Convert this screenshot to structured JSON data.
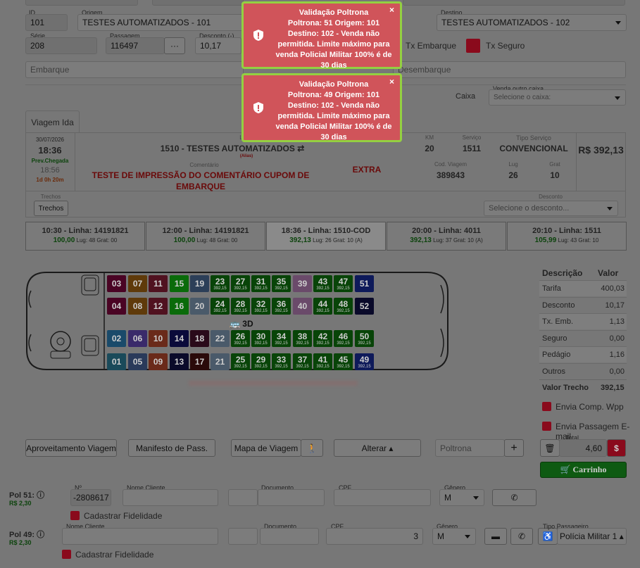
{
  "header": {
    "id_label": "ID",
    "id_value": "101",
    "origem_label": "Origem",
    "origem_value": "TESTES AUTOMATIZADOS - 101",
    "destino_label": "Destino",
    "destino_value": "TESTES AUTOMATIZADOS - 102",
    "serie_label": "Série",
    "serie_value": "208",
    "passagem_label": "Passagem",
    "passagem_value": "116497",
    "desconto_label": "Desconto (-)",
    "desconto_value": "10,17",
    "ellipsis": "···",
    "tx_embarque_label": "Tx Embarque",
    "tx_seguro_label": "Tx Seguro",
    "embarque_placeholder": "Embarque",
    "desembarque_placeholder": "Desembarque",
    "caixa_label": "Caixa",
    "venda_outro_caixa_label": "Venda outro caixa",
    "caixa_placeholder": "Selecione o caixa:"
  },
  "tabs": [
    {
      "label": "Viagem Ida"
    }
  ],
  "trip": {
    "date": "30/07/2026",
    "time": "18:36",
    "prev_chegada_label": "Prev.Chegada",
    "arrival": "18:56",
    "duration": "1d 0h 20m",
    "linha_label": "Linha",
    "linha_value": "1510 - TESTES AUTOMATIZADOS",
    "alias": "(Alias)",
    "km_label": "KM",
    "km_value": "20",
    "servico_label": "Serviço",
    "servico_value": "1511",
    "tipo_servico_label": "Tipo Serviço",
    "tipo_servico_value": "CONVENCIONAL",
    "price": "R$ 392,13",
    "comentario_label": "Comentário",
    "comentario_value": "TESTE DE IMPRESSÃO DO COMENTÁRIO CUPOM DE EMBARQUE",
    "extra": "EXTRA",
    "cod_viagem_label": "Cod. Viagem",
    "cod_viagem_value": "389843",
    "lug_label": "Lug",
    "lug_value": "26",
    "grat_label": "Grat",
    "grat_value": "10",
    "trechos_label": "Trechos",
    "trechos_button": "Trechos",
    "desconto_label": "Desconto",
    "desconto_placeholder": "Selecione o desconto..."
  },
  "schedules": [
    {
      "title": "10:30 - Linha: 14191821",
      "price": "100,00",
      "info": "Lug: 48 Grat: 00"
    },
    {
      "title": "12:00 - Linha: 14191821",
      "price": "100,00",
      "info": "Lug: 48 Grat: 00"
    },
    {
      "title": "18:36 - Linha: 1510-COD",
      "price": "392,13",
      "info": "Lug: 26 Grat: 10 (A)"
    },
    {
      "title": "20:00 - Linha: 4011",
      "price": "392,13",
      "info": "Lug: 37 Grat: 10 (A)"
    },
    {
      "title": "20:10 - Linha: 1511",
      "price": "105,99",
      "info": "Lug: 43 Grat: 10"
    }
  ],
  "bus": {
    "label_3d": "3D",
    "seat_price": "392,15",
    "seats": [
      {
        "n": "03",
        "c": "#4a0424"
      },
      {
        "n": "07",
        "c": "#5f3a0a"
      },
      {
        "n": "11",
        "c": "#501220"
      },
      {
        "n": "15",
        "c": "#0a6b0a"
      },
      {
        "n": "19",
        "c": "#2c3f58"
      },
      {
        "n": "23",
        "c": "#084408",
        "p": true
      },
      {
        "n": "27",
        "c": "#084408",
        "p": true
      },
      {
        "n": "31",
        "c": "#084408",
        "p": true
      },
      {
        "n": "35",
        "c": "#084408",
        "p": true
      },
      {
        "n": "39",
        "c": "#6a4a6a"
      },
      {
        "n": "43",
        "c": "#084408",
        "p": true
      },
      {
        "n": "47",
        "c": "#084408",
        "p": true
      },
      {
        "n": "51",
        "c": "#0e1a5a"
      },
      {
        "n": "04",
        "c": "#4a0424"
      },
      {
        "n": "08",
        "c": "#5f3a0a"
      },
      {
        "n": "12",
        "c": "#501220"
      },
      {
        "n": "16",
        "c": "#0a6b0a"
      },
      {
        "n": "20",
        "c": "#4a5a6a"
      },
      {
        "n": "24",
        "c": "#084408",
        "p": true
      },
      {
        "n": "28",
        "c": "#084408",
        "p": true
      },
      {
        "n": "32",
        "c": "#084408",
        "p": true
      },
      {
        "n": "36",
        "c": "#084408",
        "p": true
      },
      {
        "n": "40",
        "c": "#6a4a6a"
      },
      {
        "n": "44",
        "c": "#084408",
        "p": true
      },
      {
        "n": "48",
        "c": "#084408",
        "p": true
      },
      {
        "n": "52",
        "c": "#0a0a2a"
      },
      {
        "n": "02",
        "c": "#1a4a6a"
      },
      {
        "n": "06",
        "c": "#3a2a6a"
      },
      {
        "n": "10",
        "c": "#6a2a1a"
      },
      {
        "n": "14",
        "c": "#0a0a3a"
      },
      {
        "n": "18",
        "c": "#2a0a1a"
      },
      {
        "n": "22",
        "c": "#4a5a6a"
      },
      {
        "n": "26",
        "c": "#084408",
        "p": true
      },
      {
        "n": "30",
        "c": "#084408",
        "p": true
      },
      {
        "n": "34",
        "c": "#084408",
        "p": true
      },
      {
        "n": "38",
        "c": "#084408",
        "p": true
      },
      {
        "n": "42",
        "c": "#084408",
        "p": true
      },
      {
        "n": "46",
        "c": "#084408",
        "p": true
      },
      {
        "n": "50",
        "c": "#084408",
        "p": true
      },
      {
        "n": "01",
        "c": "#1a4a5a"
      },
      {
        "n": "05",
        "c": "#2a3a5a"
      },
      {
        "n": "09",
        "c": "#6a2a1a"
      },
      {
        "n": "13",
        "c": "#0a0a2a"
      },
      {
        "n": "17",
        "c": "#2a0a0a"
      },
      {
        "n": "21",
        "c": "#4a5a6a"
      },
      {
        "n": "25",
        "c": "#084408",
        "p": true
      },
      {
        "n": "29",
        "c": "#084408",
        "p": true
      },
      {
        "n": "33",
        "c": "#084408",
        "p": true
      },
      {
        "n": "37",
        "c": "#084408",
        "p": true
      },
      {
        "n": "41",
        "c": "#084408",
        "p": true
      },
      {
        "n": "45",
        "c": "#084408",
        "p": true
      },
      {
        "n": "49",
        "c": "#0e1a5a",
        "p": true
      }
    ]
  },
  "totals": {
    "descricao_header": "Descrição",
    "valor_header": "Valor",
    "rows": [
      {
        "label": "Tarifa",
        "value": "400,03"
      },
      {
        "label": "Desconto",
        "value": "10,17"
      },
      {
        "label": "Tx. Emb.",
        "value": "1,13"
      },
      {
        "label": "Seguro",
        "value": "0,00"
      },
      {
        "label": "Pedágio",
        "value": "1,16"
      },
      {
        "label": "Outros",
        "value": "0,00"
      }
    ],
    "valor_trecho_label": "Valor Trecho",
    "valor_trecho_value": "392,15",
    "envia_wpp": "Envia Comp. Wpp",
    "envia_email": "Envia Passagem E-mail",
    "total_label": "Total",
    "total_value": "4,60",
    "carrinho": "Carrinho"
  },
  "actions": {
    "aproveitamento": "Aproveitamento Viagem",
    "manifesto": "Manifesto de Pass.",
    "mapa": "Mapa de Viagem",
    "alterar": "Alterar",
    "poltrona_placeholder": "Poltrona",
    "plus": "+"
  },
  "passengers": [
    {
      "pol": "Pol 51:",
      "price": "R$ 2,30",
      "n_label": "Nº",
      "n_value": "-2808617",
      "nome_label": "Nome Cliente",
      "doc_label": "Documento",
      "cpf_label": "CPF",
      "genero_label": "Gênero",
      "genero_value": "M",
      "fidelidade": "Cadastrar Fidelidade"
    },
    {
      "pol": "Pol 49:",
      "price": "R$ 2,30",
      "nome_label": "Nome Cliente",
      "doc_label": "Documento",
      "cpf_label": "CPF",
      "cpf_partial": "3",
      "genero_label": "Gênero",
      "genero_value": "M",
      "tipo_label": "Tipo Passageiro",
      "tipo_value": "Polícia Militar 1",
      "fidelidade": "Cadastrar Fidelidade"
    }
  ],
  "toasts": [
    {
      "title": "Validação Poltrona",
      "message": "Poltrona: 51 Origem: 101 Destino: 102 - Venda não permitida. Limite máximo para venda Policial Militar 100% é de 30 dias"
    },
    {
      "title": "Validação Poltrona",
      "message": "Poltrona: 49 Origem: 101 Destino: 102 - Venda não permitida. Limite máximo para venda Policial Militar 100% é de 30 dias"
    }
  ],
  "colors": {
    "toast_bg": "#d0545a",
    "toast_border": "#94d041",
    "carrinho": "#0e5a12",
    "dollar": "#8a0a1c"
  }
}
